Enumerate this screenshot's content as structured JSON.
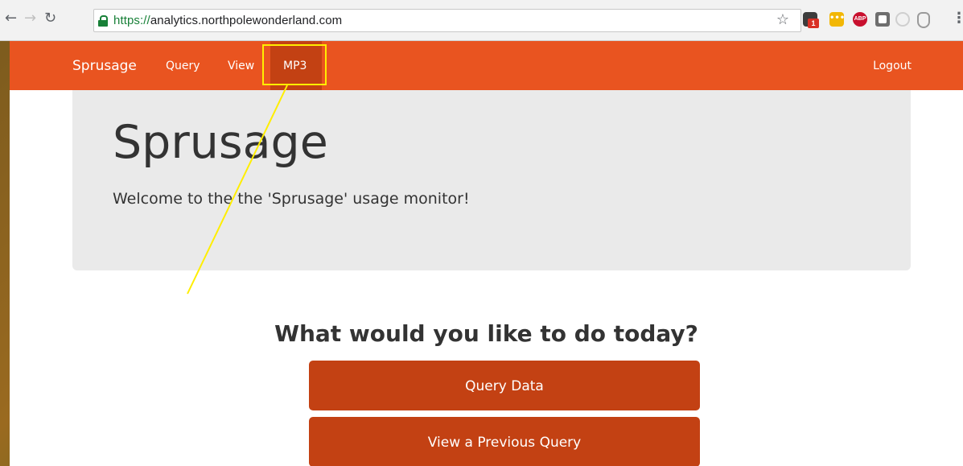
{
  "browser": {
    "url_scheme": "https://",
    "url_host": "analytics.northpolewonderland.com",
    "extension_badge": "1",
    "abp_label": "ABP",
    "ext2_label": "•••"
  },
  "navbar": {
    "brand": "Sprusage",
    "links": [
      "Query",
      "View",
      "MP3"
    ],
    "logout": "Logout",
    "color": "#e95420",
    "active_color": "#c34113"
  },
  "jumbotron": {
    "title": "Sprusage",
    "subtitle": "Welcome to the the 'Sprusage' usage monitor!"
  },
  "main": {
    "question": "What would you like to do today?",
    "buttons": [
      "Query Data",
      "View a Previous Query"
    ]
  },
  "annotation": {
    "color": "#ffee00"
  }
}
